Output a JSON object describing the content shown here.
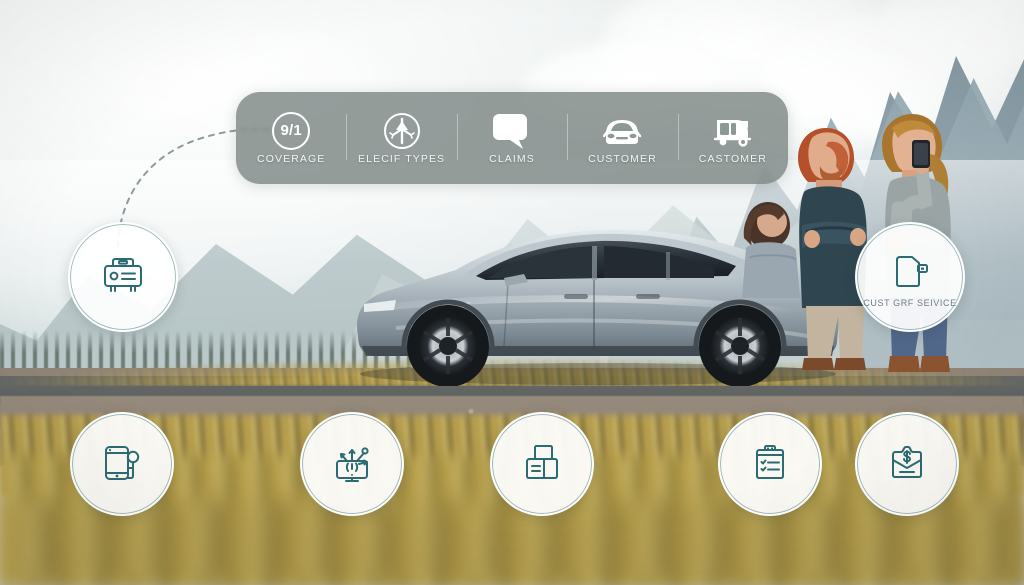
{
  "scene": {
    "description": "Electric sedan parked on a mountain roadside with three people",
    "colors": {
      "accent_teal": "#2c6b73",
      "toolbar_bg": "#7a8582",
      "badge_bg": "#ffffff",
      "label_grey": "#6d7d80",
      "grass_gold": "#d2b558",
      "car_silver": "#b9c2c6"
    }
  },
  "toolbar": {
    "items": [
      {
        "id": "coverage",
        "icon": "numeric-badge-icon",
        "badge_text": "9/1",
        "label": "COVERAGE"
      },
      {
        "id": "elecif-types",
        "icon": "tree-arrow-icon",
        "badge_text": "",
        "label": "ELECIF TYPES"
      },
      {
        "id": "claims",
        "icon": "speech-bubble-icon",
        "badge_text": "",
        "label": "CLAIMS"
      },
      {
        "id": "customer",
        "icon": "car-front-icon",
        "badge_text": "",
        "label": "CUSTOMER"
      },
      {
        "id": "castomer",
        "icon": "delivery-truck-icon",
        "badge_text": "",
        "label": "CASTOMER"
      }
    ]
  },
  "badges": {
    "left": {
      "id": "machine",
      "icon": "appliance-machine-icon",
      "label": ""
    },
    "right": {
      "id": "cust-service",
      "icon": "document-tag-icon",
      "label": "CUST GRF SEIVICE"
    },
    "bottom": [
      {
        "id": "mobile-user",
        "icon": "smartphone-user-icon",
        "label": ""
      },
      {
        "id": "connected",
        "icon": "monitor-network-icon",
        "label": ""
      },
      {
        "id": "printer",
        "icon": "printer-document-icon",
        "label": ""
      },
      {
        "id": "checklist",
        "icon": "clipboard-checklist-icon",
        "label": ""
      },
      {
        "id": "payment",
        "icon": "dollar-envelope-icon",
        "label": ""
      }
    ]
  }
}
